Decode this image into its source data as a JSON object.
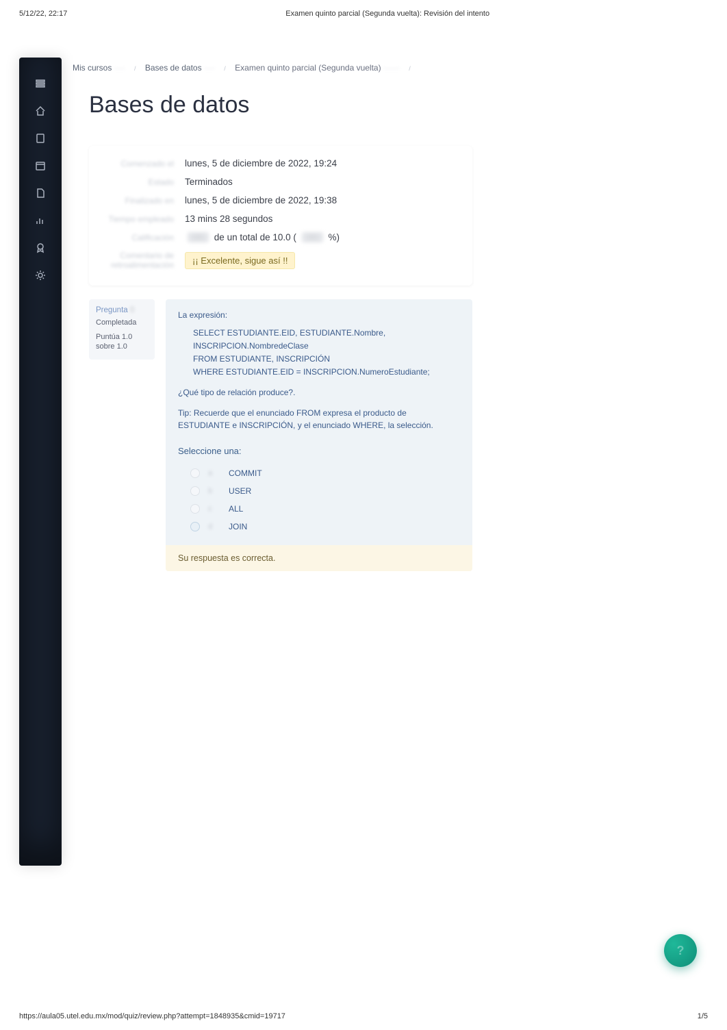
{
  "print": {
    "datetime": "5/12/22, 22:17",
    "doc_title": "Examen quinto parcial (Segunda vuelta): Revisión del intento",
    "url": "https://aula05.utel.edu.mx/mod/quiz/review.php?attempt=1848935&cmid=19717",
    "page": "1/5"
  },
  "breadcrumb": {
    "items": [
      "Mis cursos",
      "Bases de datos",
      "Examen quinto parcial (Segunda vuelta)"
    ]
  },
  "page_title": "Bases de datos",
  "summary": {
    "rows": [
      {
        "label": "Comenzado el",
        "value": "lunes, 5 de diciembre de 2022, 19:24"
      },
      {
        "label": "Estado",
        "value": "Terminados"
      },
      {
        "label": "Finalizado en",
        "value": "lunes, 5 de diciembre de 2022, 19:38"
      },
      {
        "label": "Tiempo empleado",
        "value": "13 mins 28 segundos"
      }
    ],
    "grade": {
      "label": "Calificación",
      "mid": " de un total de 10.0 (",
      "suffix": "%)"
    },
    "feedback": {
      "label": "Comentario de retroalimentación",
      "value": "¡¡ Excelente, sigue así !!"
    }
  },
  "question": {
    "label": "Pregunta",
    "state": "Completada",
    "mark": "Puntúa 1.0 sobre 1.0",
    "intro": "La expresión:",
    "code": [
      "SELECT ESTUDIANTE.EID, ESTUDIANTE.Nombre,",
      "INSCRIPCION.NombredeClase",
      "FROM ESTUDIANTE, INSCRIPCIÓN",
      "WHERE ESTUDIANTE.EID = INSCRIPCION.NumeroEstudiante;"
    ],
    "qtext": "¿Qué tipo de relación produce?.",
    "tip": "Tip: Recuerde que el enunciado FROM expresa el producto de ESTUDIANTE e INSCRIPCIÓN, y el enunciado WHERE, la selección.",
    "select_one": "Seleccione una:",
    "options": [
      {
        "label": "COMMIT",
        "selected": false
      },
      {
        "label": "USER",
        "selected": false
      },
      {
        "label": "ALL",
        "selected": false
      },
      {
        "label": "JOIN",
        "selected": true
      }
    ],
    "feedback": "Su respuesta es correcta."
  }
}
